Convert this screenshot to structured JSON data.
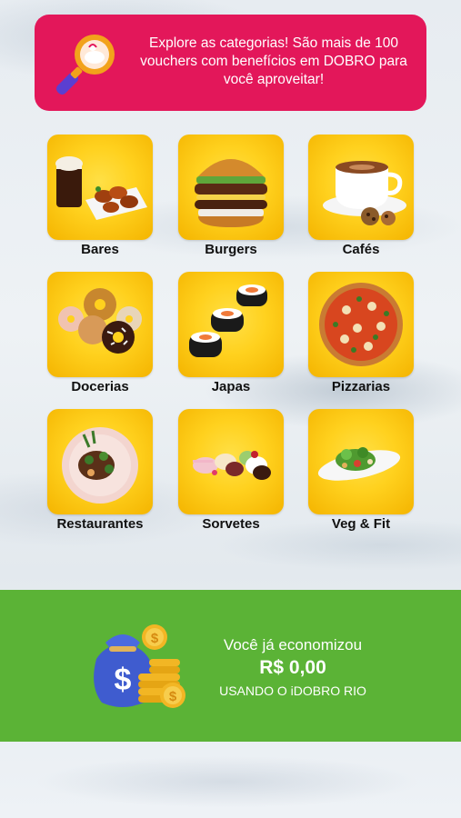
{
  "promo_banner": {
    "text": "Explore as categorias! São mais de 100\nvouchers com benefícios em DOBRO para\nvocê aproveitar!",
    "icon": "magnifier-icon",
    "color": "#e3175a"
  },
  "categories": [
    {
      "label": "Bares",
      "icon": "beer-and-wings-icon"
    },
    {
      "label": "Burgers",
      "icon": "burger-icon"
    },
    {
      "label": "Cafés",
      "icon": "coffee-cup-icon"
    },
    {
      "label": "Docerias",
      "icon": "donuts-icon"
    },
    {
      "label": "Japas",
      "icon": "sushi-icon"
    },
    {
      "label": "Pizzarias",
      "icon": "pizza-icon"
    },
    {
      "label": "Restaurantes",
      "icon": "plated-dish-icon"
    },
    {
      "label": "Sorvetes",
      "icon": "ice-cream-icon"
    },
    {
      "label": "Veg & Fit",
      "icon": "salad-icon"
    }
  ],
  "savings": {
    "title": "Você já economizou",
    "amount": "R$ 0,00",
    "subtitle": "USANDO O iDOBRO RIO",
    "icon": "money-bag-icon",
    "color": "#5bb336"
  },
  "colors": {
    "tile_yellow": "#ffd11e"
  }
}
